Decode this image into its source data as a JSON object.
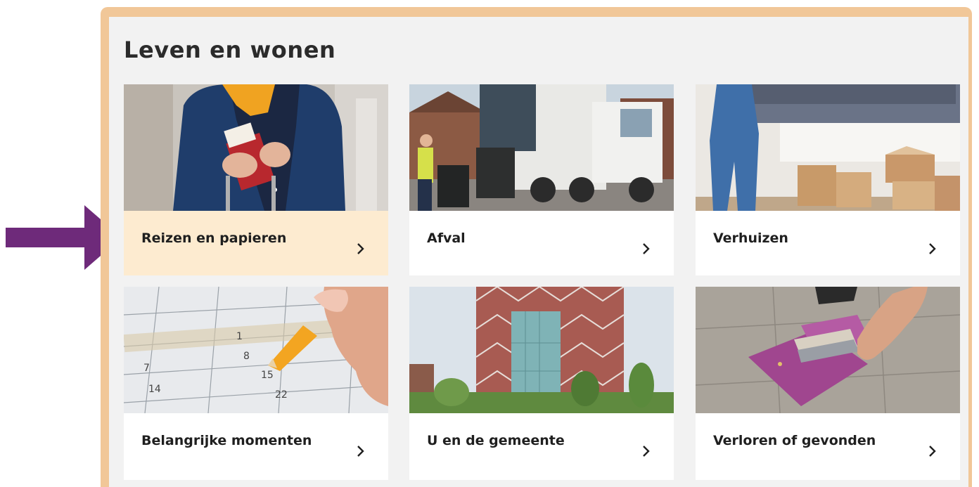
{
  "section": {
    "title": "Leven en wonen"
  },
  "cards": [
    {
      "label": "Reizen en papieren",
      "image": "traveler-passport-photo",
      "active": true
    },
    {
      "label": "Afval",
      "image": "garbage-truck-photo",
      "active": false
    },
    {
      "label": "Verhuizen",
      "image": "moving-boxes-photo",
      "active": false
    },
    {
      "label": "Belangrijke momenten",
      "image": "calendar-pencil-photo",
      "active": false
    },
    {
      "label": "U en de gemeente",
      "image": "city-hall-building-photo",
      "active": false
    },
    {
      "label": "Verloren of gevonden",
      "image": "lost-wallet-photo",
      "active": false
    }
  ],
  "calendar_numbers": [
    "1",
    "8",
    "15",
    "22",
    "7",
    "14"
  ],
  "colors": {
    "frame": "#f1c798",
    "panel": "#f2f2f2",
    "active_card": "#fdebd0",
    "annotation_arrow": "#6e2a7a"
  },
  "icons": {
    "annotation": "arrow-right-icon",
    "card_link": "chevron-right-icon"
  }
}
